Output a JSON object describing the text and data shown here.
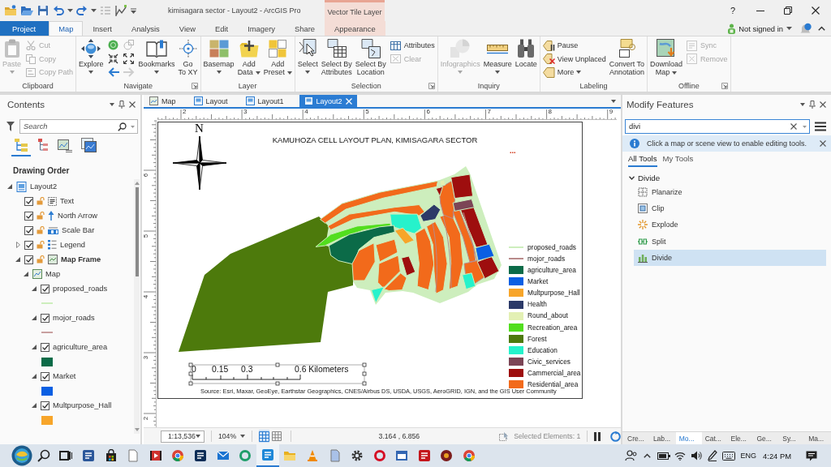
{
  "window": {
    "title": "kimisagara sector - Layout2 - ArcGIS Pro",
    "contextual_header": "Vector Tile Layer",
    "help": "?"
  },
  "account": {
    "label": "Not signed in"
  },
  "ribbon": {
    "tabs": [
      {
        "label": "Project",
        "kind": "backstage",
        "selected": false
      },
      {
        "label": "Map",
        "kind": "core",
        "selected": true
      },
      {
        "label": "Insert",
        "kind": "core",
        "selected": false
      },
      {
        "label": "Analysis",
        "kind": "core",
        "selected": false
      },
      {
        "label": "View",
        "kind": "core",
        "selected": false
      },
      {
        "label": "Edit",
        "kind": "core",
        "selected": false
      },
      {
        "label": "Imagery",
        "kind": "core",
        "selected": false
      },
      {
        "label": "Share",
        "kind": "core",
        "selected": false
      },
      {
        "label": "Appearance",
        "kind": "contextual",
        "selected": false
      }
    ],
    "groups": [
      {
        "label": "Clipboard",
        "buttons": [
          {
            "label": "Paste",
            "kind": "large",
            "disabled": true,
            "dropdown": true
          },
          {
            "label": "Cut",
            "kind": "small",
            "disabled": true
          },
          {
            "label": "Copy",
            "kind": "small",
            "disabled": true
          },
          {
            "label": "Copy Path",
            "kind": "small",
            "disabled": true
          }
        ]
      },
      {
        "label": "Navigate",
        "launcher": true,
        "buttons": [
          {
            "label": "Explore",
            "kind": "large",
            "disabled": false,
            "dropdown": true
          },
          {
            "kind": "icon",
            "disabled": false
          },
          {
            "kind": "icon",
            "disabled": true
          },
          {
            "kind": "icon",
            "disabled": false
          },
          {
            "kind": "icon",
            "disabled": false
          },
          {
            "kind": "icon",
            "disabled": false
          },
          {
            "kind": "icon",
            "disabled": true
          },
          {
            "label": "Bookmarks",
            "kind": "large",
            "disabled": false,
            "dropdown": true
          },
          {
            "label": "Go\nTo XY",
            "kind": "large",
            "disabled": false
          }
        ]
      },
      {
        "label": "Layer",
        "buttons": [
          {
            "label": "Basemap",
            "kind": "large",
            "disabled": false,
            "dropdown": true
          },
          {
            "label": "Add\nData",
            "kind": "large",
            "disabled": false,
            "dropdown": true
          },
          {
            "label": "Add\nPreset",
            "kind": "large",
            "disabled": false,
            "dropdown": true
          }
        ]
      },
      {
        "label": "Selection",
        "launcher": true,
        "buttons": [
          {
            "label": "Select",
            "kind": "large",
            "disabled": false,
            "dropdown": true
          },
          {
            "label": "Select By\nAttributes",
            "kind": "large",
            "disabled": false
          },
          {
            "label": "Select By\nLocation",
            "kind": "large",
            "disabled": false
          },
          {
            "label": "Attributes",
            "kind": "small",
            "disabled": false
          },
          {
            "label": "Clear",
            "kind": "small",
            "disabled": true
          }
        ]
      },
      {
        "label": "Inquiry",
        "buttons": [
          {
            "label": "Infographics",
            "kind": "large",
            "disabled": true,
            "dropdown": true
          },
          {
            "label": "Measure",
            "kind": "large",
            "disabled": false,
            "dropdown": true
          },
          {
            "label": "Locate",
            "kind": "large",
            "disabled": false
          }
        ]
      },
      {
        "label": "Labeling",
        "buttons": [
          {
            "label": "Pause",
            "kind": "small",
            "disabled": false
          },
          {
            "label": "View Unplaced",
            "kind": "small",
            "disabled": false
          },
          {
            "label": "More",
            "kind": "small",
            "disabled": false,
            "dropdown": true
          },
          {
            "label": "Convert To\nAnnotation",
            "kind": "large",
            "disabled": false
          }
        ]
      },
      {
        "label": "Offline",
        "launcher": true,
        "buttons": [
          {
            "label": "Download\nMap",
            "kind": "large",
            "disabled": false,
            "dropdown": true
          },
          {
            "label": "Sync",
            "kind": "small",
            "disabled": true
          },
          {
            "label": "Remove",
            "kind": "small",
            "disabled": true
          }
        ]
      }
    ]
  },
  "contents": {
    "title": "Contents",
    "search": {
      "placeholder": "Search"
    },
    "view_tabs": [
      {
        "selected": true
      },
      {
        "selected": false
      },
      {
        "selected": false
      },
      {
        "selected": false
      }
    ],
    "heading": "Drawing Order",
    "tree": [
      {
        "label": "Layout2",
        "kind": "layout",
        "expanded": true,
        "children": [
          {
            "label": "Text",
            "kind": "text_element",
            "checked": true,
            "active": false
          },
          {
            "label": "North Arrow",
            "kind": "north_arrow",
            "checked": true,
            "active": false
          },
          {
            "label": "Scale Bar",
            "kind": "scale_bar",
            "checked": true,
            "active": false
          },
          {
            "label": "Legend",
            "kind": "legend",
            "checked": true,
            "active": false,
            "expanded": false
          },
          {
            "label": "Map Frame",
            "kind": "map_frame",
            "checked": true,
            "active": true,
            "expanded": true,
            "children": [
              {
                "label": "Map",
                "kind": "map",
                "expanded": true,
                "children": [
                  {
                    "label": "proposed_roads",
                    "checked": true,
                    "expanded": true,
                    "symbol": {
                      "kind": "line",
                      "color": "#cdeebd"
                    }
                  },
                  {
                    "label": "mojor_roads",
                    "checked": true,
                    "expanded": true,
                    "symbol": {
                      "kind": "line",
                      "color": "#c9a0a0"
                    }
                  },
                  {
                    "label": "agriculture_area",
                    "checked": true,
                    "expanded": true,
                    "symbol": {
                      "kind": "fill",
                      "color": "#0b6b48"
                    }
                  },
                  {
                    "label": "Market",
                    "checked": true,
                    "expanded": true,
                    "symbol": {
                      "kind": "fill",
                      "color": "#0a5fe3"
                    }
                  },
                  {
                    "label": "Multpurpose_Hall",
                    "checked": true,
                    "expanded": true,
                    "symbol": {
                      "kind": "fill",
                      "color": "#f7a52a"
                    }
                  }
                ]
              }
            ]
          }
        ]
      }
    ]
  },
  "layout_view": {
    "tabs": [
      {
        "label": "Map",
        "kind": "map",
        "selected": false
      },
      {
        "label": "Layout",
        "kind": "layout",
        "selected": false
      },
      {
        "label": "Layout1",
        "kind": "layout",
        "selected": false
      },
      {
        "label": "Layout2",
        "kind": "layout",
        "selected": true
      }
    ],
    "rulers": {
      "horizontal": [
        "2",
        "3",
        "4",
        "5",
        "6",
        "7",
        "8",
        "9"
      ],
      "vertical": [
        "6",
        "5",
        "4",
        "3",
        "2"
      ]
    },
    "page": {
      "north_label": "N",
      "title": "KAMUHOZA CELL LAYOUT PLAN, KIMISAGARA SECTOR",
      "marker": "...",
      "legend": [
        {
          "label": "proposed_roads",
          "kind": "line",
          "color": "#cdeebd"
        },
        {
          "label": "mojor_roads",
          "kind": "line",
          "color": "#b88a8a"
        },
        {
          "label": "agriculture_area",
          "kind": "fill",
          "color": "#0b6b48"
        },
        {
          "label": "Market",
          "kind": "fill",
          "color": "#0a5fe3"
        },
        {
          "label": "Multpurpose_Hall",
          "kind": "fill",
          "color": "#f7a52a"
        },
        {
          "label": "Health",
          "kind": "fill",
          "color": "#2c3a68"
        },
        {
          "label": "Round_about",
          "kind": "fill",
          "color": "#e3f0b4"
        },
        {
          "label": "Recreation_area",
          "kind": "fill",
          "color": "#52de1e"
        },
        {
          "label": "Forest",
          "kind": "fill",
          "color": "#4d7a0c"
        },
        {
          "label": "Education",
          "kind": "fill",
          "color": "#26f2cb"
        },
        {
          "label": "Civic_services",
          "kind": "fill",
          "color": "#7c4556"
        },
        {
          "label": "Cammercial_area",
          "kind": "fill",
          "color": "#9e0e0e"
        },
        {
          "label": "Residential_area",
          "kind": "fill",
          "color": "#f26a1b"
        }
      ],
      "scale_labels": [
        "0",
        "0.15",
        "0.3",
        "0.6 Kilometers"
      ],
      "credits": "Source: Esri, Maxar, GeoEye, Earthstar Geographics, CNES/Airbus DS, USDA, USGS, AeroGRID, IGN, and the GIS User Community"
    },
    "status": {
      "scale": "1:13,536",
      "zoom": "104%",
      "toggles": [
        {
          "on": true
        },
        {
          "on": false
        }
      ],
      "coordinates": "3.164 , 6.856",
      "selected_elements": "Selected Elements: 1"
    }
  },
  "modify_features": {
    "title": "Modify Features",
    "search": {
      "value": "divi"
    },
    "notice": "Click a map or scene view to enable editing tools.",
    "tabs": [
      {
        "label": "All Tools",
        "selected": true
      },
      {
        "label": "My Tools",
        "selected": false
      }
    ],
    "groups": [
      {
        "label": "Divide",
        "expanded": true,
        "tools": [
          {
            "label": "Planarize",
            "selected": false
          },
          {
            "label": "Clip",
            "selected": false
          },
          {
            "label": "Explode",
            "selected": false
          },
          {
            "label": "Split",
            "selected": false
          },
          {
            "label": "Divide",
            "selected": true
          }
        ]
      }
    ]
  },
  "dock_tabs": [
    {
      "label": "Cre...",
      "selected": false
    },
    {
      "label": "Lab...",
      "selected": false
    },
    {
      "label": "Mo...",
      "selected": true
    },
    {
      "label": "Cat...",
      "selected": false
    },
    {
      "label": "Ele...",
      "selected": false
    },
    {
      "label": "Ge...",
      "selected": false
    },
    {
      "label": "Sy...",
      "selected": false
    },
    {
      "label": "Ma...",
      "selected": false
    }
  ],
  "taskbar": {
    "apps": [
      {
        "kind": "search",
        "color": "#222222",
        "selected": false
      },
      {
        "kind": "taskview",
        "color": "#222222",
        "selected": false
      },
      {
        "kind": "tile",
        "color": "#2b579a",
        "selected": false
      },
      {
        "kind": "bag",
        "color": "#222222",
        "selected": false
      },
      {
        "kind": "page",
        "color": "#ffffff",
        "selected": false
      },
      {
        "kind": "film",
        "color": "#d0312d",
        "selected": false
      },
      {
        "kind": "wheel",
        "color": "#db4437",
        "selected": false
      },
      {
        "kind": "tile",
        "color": "#0c2d57",
        "selected": false
      },
      {
        "kind": "mail",
        "color": "#1a73d1",
        "selected": false
      },
      {
        "kind": "ring",
        "color": "#1f9e6a",
        "selected": false
      },
      {
        "kind": "tile",
        "color": "#1e88d8",
        "selected": true
      },
      {
        "kind": "folder",
        "color": "#e8b020",
        "selected": false
      },
      {
        "kind": "cone",
        "color": "#f08a00",
        "selected": false
      },
      {
        "kind": "page",
        "color": "#a9c1e8",
        "selected": false
      },
      {
        "kind": "gear",
        "color": "#333333",
        "selected": false
      },
      {
        "kind": "ring",
        "color": "#d50f25",
        "selected": false
      },
      {
        "kind": "window",
        "color": "#3266b2",
        "selected": false
      },
      {
        "kind": "tile",
        "color": "#c4161c",
        "selected": false
      },
      {
        "kind": "disc",
        "color": "#7a1c1c",
        "selected": false
      },
      {
        "kind": "wheel",
        "color": "#db4437",
        "selected": false
      }
    ],
    "language": "ENG",
    "time": "4:24 PM"
  }
}
